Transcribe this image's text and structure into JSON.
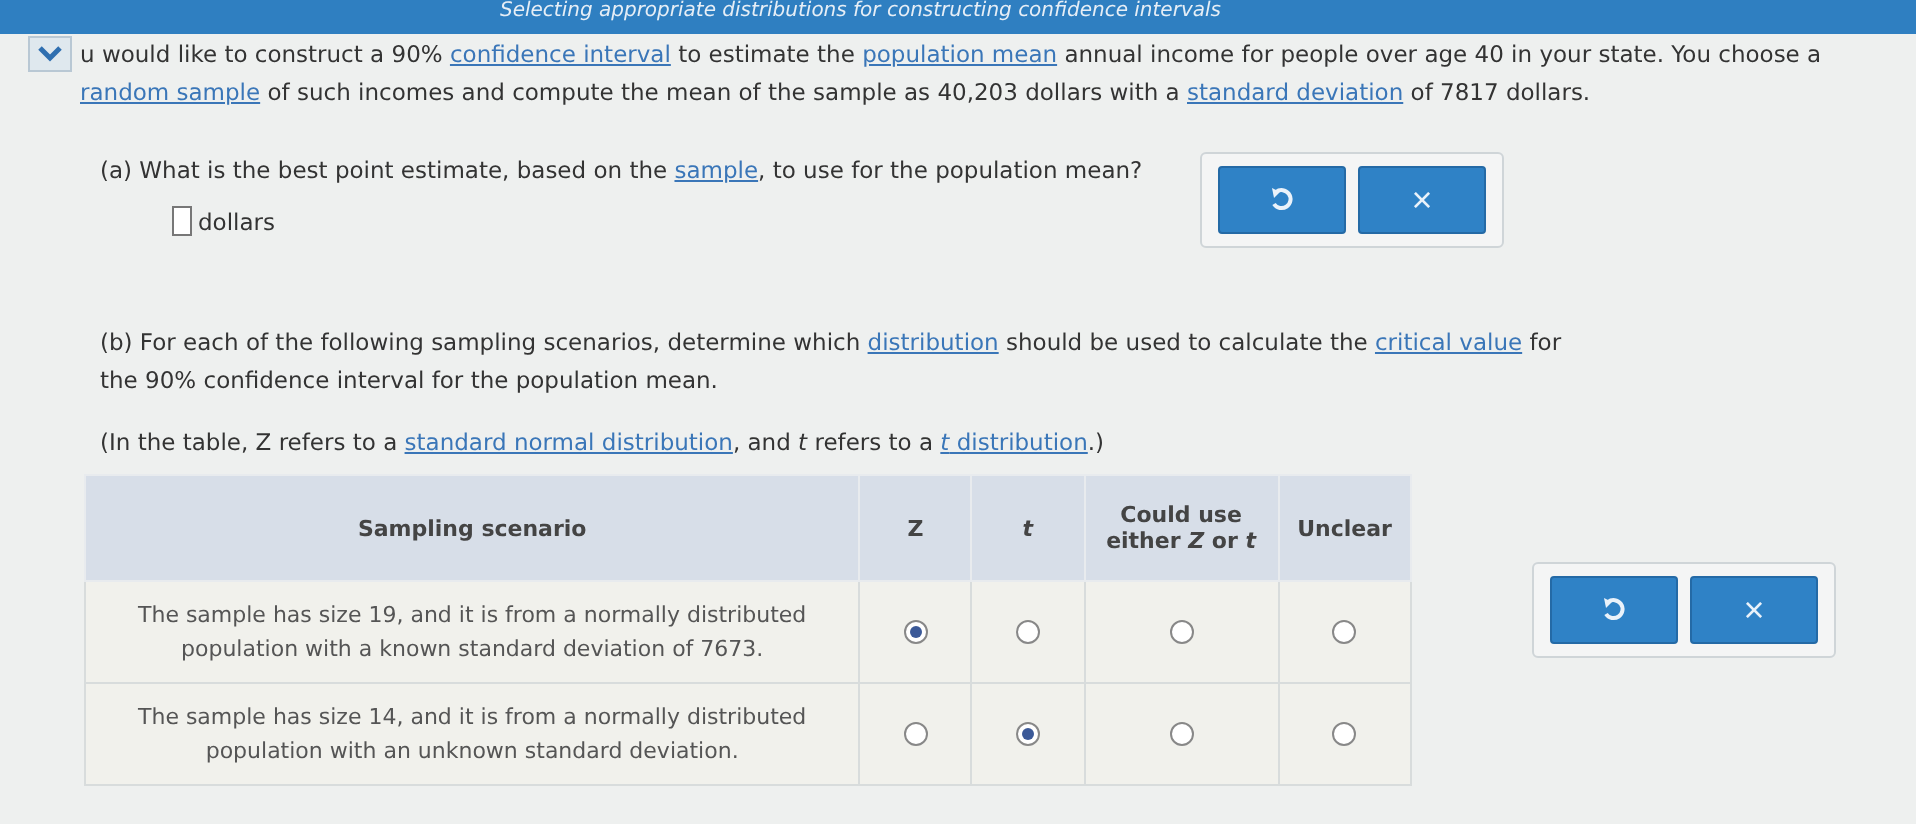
{
  "header": {
    "title": "Selecting appropriate distributions for constructing confidence intervals"
  },
  "intro": [
    {
      "text": "u would like to construct a 90% ",
      "kind": "text"
    },
    {
      "text": "confidence interval",
      "kind": "link"
    },
    {
      "text": " to estimate the ",
      "kind": "text"
    },
    {
      "text": "population mean",
      "kind": "link"
    },
    {
      "text": " annual income for people over age 40 in your state. You choose a ",
      "kind": "text"
    },
    {
      "text": "random sample",
      "kind": "link"
    },
    {
      "text": " of such incomes and compute the mean of the sample as 40,203 dollars with a ",
      "kind": "text"
    },
    {
      "text": "standard deviation",
      "kind": "link"
    },
    {
      "text": " of 7817 dollars.",
      "kind": "text"
    }
  ],
  "part_a": {
    "question": [
      {
        "text": "(a) What is the best point estimate, based on the ",
        "kind": "text"
      },
      {
        "text": "sample",
        "kind": "link"
      },
      {
        "text": ", to use for the population mean?",
        "kind": "text"
      }
    ],
    "unit": "dollars",
    "close_label": "×"
  },
  "part_b": {
    "question": [
      {
        "text": "(b) For each of the following sampling scenarios, determine which ",
        "kind": "text"
      },
      {
        "text": "distribution",
        "kind": "link"
      },
      {
        "text": " should be used to calculate the ",
        "kind": "text"
      },
      {
        "text": "critical value",
        "kind": "link"
      },
      {
        "text": " for the 90% confidence interval for the population mean.",
        "kind": "text"
      }
    ],
    "note": [
      {
        "text": "(In the table, Z refers to a ",
        "kind": "text"
      },
      {
        "text": "standard normal distribution",
        "kind": "link"
      },
      {
        "text": ", and *t* refers to a ",
        "kind": "text"
      },
      {
        "text": "*t* distribution",
        "kind": "link"
      },
      {
        "text": ".)",
        "kind": "text"
      }
    ],
    "table": {
      "columns": [
        "Sampling scenario",
        "Z",
        "*t*",
        "Could use either *Z* or *t*",
        "Unclear"
      ],
      "rows": [
        {
          "scenario": "The sample has size 19, and it is from a normally distributed population with a known standard deviation of 7673.",
          "options": [
            {
              "selected": true
            },
            {
              "selected": false
            },
            {
              "selected": false
            },
            {
              "selected": false
            }
          ]
        },
        {
          "scenario": "The sample has size 14, and it is from a normally distributed population with an unknown standard deviation.",
          "options": [
            {
              "selected": false
            },
            {
              "selected": true
            },
            {
              "selected": false
            },
            {
              "selected": false
            }
          ]
        }
      ]
    },
    "close_label": "×"
  }
}
